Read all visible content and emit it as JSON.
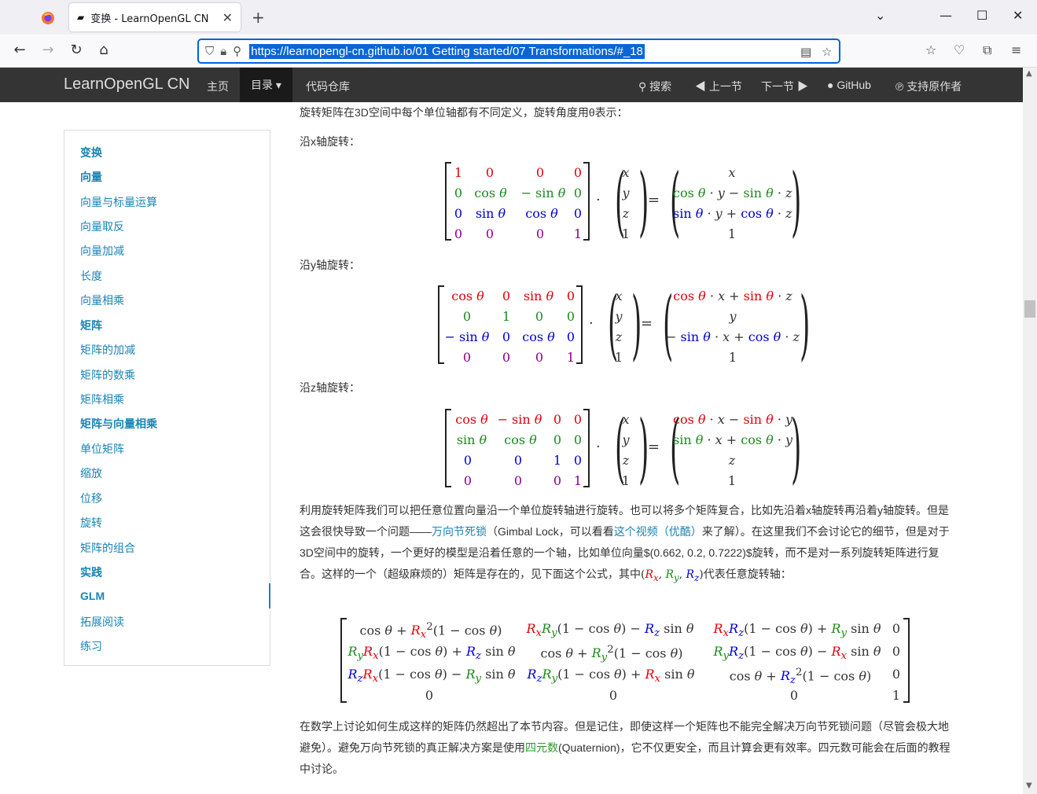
{
  "browser": {
    "tab_title": "变换 - LearnOpenGL CN",
    "url": "https://learnopengl-cn.github.io/01 Getting started/07 Transformations/#_18"
  },
  "site": {
    "brand": "LearnOpenGL CN",
    "nav": {
      "home": "主页",
      "toc": "目录 ▾",
      "repo": "代码仓库",
      "search": "搜索",
      "prev": "上一节",
      "next": "下一节",
      "github": "GitHub",
      "support": "支持原作者"
    }
  },
  "toc": [
    {
      "label": "变换",
      "bold": true
    },
    {
      "label": "向量",
      "bold": true
    },
    {
      "label": "向量与标量运算",
      "bold": false
    },
    {
      "label": "向量取反",
      "bold": false
    },
    {
      "label": "向量加减",
      "bold": false
    },
    {
      "label": "长度",
      "bold": false
    },
    {
      "label": "向量相乘",
      "bold": false
    },
    {
      "label": "矩阵",
      "bold": true
    },
    {
      "label": "矩阵的加减",
      "bold": false
    },
    {
      "label": "矩阵的数乘",
      "bold": false
    },
    {
      "label": "矩阵相乘",
      "bold": false
    },
    {
      "label": "矩阵与向量相乘",
      "bold": true
    },
    {
      "label": "单位矩阵",
      "bold": false
    },
    {
      "label": "缩放",
      "bold": false
    },
    {
      "label": "位移",
      "bold": false
    },
    {
      "label": "旋转",
      "bold": false
    },
    {
      "label": "矩阵的组合",
      "bold": false
    },
    {
      "label": "实践",
      "bold": true
    },
    {
      "label": "GLM",
      "bold": true
    },
    {
      "label": "拓展阅读",
      "bold": false
    },
    {
      "label": "练习",
      "bold": false
    }
  ],
  "content": {
    "intro": "旋转矩阵在3D空间中每个单位轴都有不同定义，旋转角度用θ表示：",
    "x_axis": "沿x轴旋转：",
    "y_axis": "沿y轴旋转：",
    "z_axis": "沿z轴旋转：",
    "para1_a": "利用旋转矩阵我们可以把任意位置向量沿一个单位旋转轴进行旋转。也可以将多个矩阵复合，比如先沿着x轴旋转再沿着y轴旋转。但是这会很快导致一个问题——",
    "para1_link1": "万向节死锁",
    "para1_b": "（Gimbal Lock，可以看看",
    "para1_link2": "这个视频（优酷）",
    "para1_c": "来了解）。在这里我们不会讨论它的细节，但是对于3D空间中的旋转，一个更好的模型是沿着任意的一个轴，比如单位向量$(0.662, 0.2, 0.7222)$旋转，而不是对一系列旋转矩阵进行复合。这样的一个（超级麻烦的）矩阵是存在的，见下面这个公式，其中",
    "para1_d": "代表任意旋转轴：",
    "para2_a": "在数学上讨论如何生成这样的矩阵仍然超出了本节内容。但是记住，即使这样一个矩阵也不能完全解决万向节死锁问题（尽管会极大地避免）。避免万向节死锁的真正解决方案是使用",
    "para2_link": "四元数",
    "para2_b": "(Quaternion)，它不仅更安全，而且计算会更有效率。四元数可能会在后面的教程中讨论。"
  }
}
